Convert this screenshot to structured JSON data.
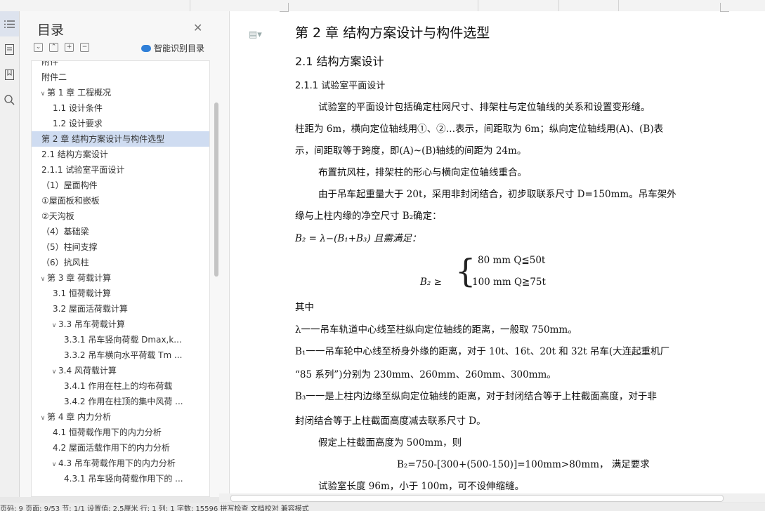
{
  "toc": {
    "title": "目录",
    "smart_label": "智能识别目录",
    "items": [
      {
        "label": "附件",
        "indent": 0,
        "arrow": ""
      },
      {
        "label": "附件二",
        "indent": 0,
        "arrow": ""
      },
      {
        "label": "第 1 章  工程概况",
        "indent": 0,
        "arrow": "∨"
      },
      {
        "label": "1.1  设计条件",
        "indent": 1,
        "arrow": ""
      },
      {
        "label": "1.2 设计要求",
        "indent": 1,
        "arrow": ""
      },
      {
        "label": "第 2 章   结构方案设计与构件选型",
        "indent": 0,
        "arrow": "",
        "selected": true
      },
      {
        "label": "2.1  结构方案设计",
        "indent": 0,
        "arrow": ""
      },
      {
        "label": "2.1.1  试验室平面设计",
        "indent": 0,
        "arrow": ""
      },
      {
        "label": "（1）屋面构件",
        "indent": 0,
        "arrow": ""
      },
      {
        "label": "①屋面板和嵌板",
        "indent": 0,
        "arrow": ""
      },
      {
        "label": "②天沟板",
        "indent": 0,
        "arrow": ""
      },
      {
        "label": "（4）基础梁",
        "indent": 0,
        "arrow": ""
      },
      {
        "label": "（5）柱间支撑",
        "indent": 0,
        "arrow": ""
      },
      {
        "label": "（6）抗风柱",
        "indent": 0,
        "arrow": ""
      },
      {
        "label": "第 3 章    荷载计算",
        "indent": 0,
        "arrow": "∨"
      },
      {
        "label": "3.1  恒荷载计算",
        "indent": 1,
        "arrow": ""
      },
      {
        "label": "3.2  屋面活荷载计算",
        "indent": 1,
        "arrow": ""
      },
      {
        "label": "3.3  吊车荷载计算",
        "indent": 1,
        "arrow": "∨"
      },
      {
        "label": "3.3.1  吊车竖向荷载 Dmax,k...",
        "indent": 2,
        "arrow": ""
      },
      {
        "label": "3.3.2  吊车横向水平荷载 Tm ...",
        "indent": 2,
        "arrow": ""
      },
      {
        "label": "3.4    风荷载计算",
        "indent": 1,
        "arrow": "∨"
      },
      {
        "label": "3.4.1  作用在柱上的均布荷载",
        "indent": 2,
        "arrow": ""
      },
      {
        "label": "3.4.2  作用在柱顶的集中风荷 ...",
        "indent": 2,
        "arrow": ""
      },
      {
        "label": "第 4 章    内力分析",
        "indent": 0,
        "arrow": "∨"
      },
      {
        "label": "4.1  恒荷载作用下的内力分析",
        "indent": 1,
        "arrow": ""
      },
      {
        "label": "4.2  屋面活载作用下的内力分析",
        "indent": 1,
        "arrow": ""
      },
      {
        "label": "4.3  吊车荷载作用下的内力分析",
        "indent": 1,
        "arrow": "∨"
      },
      {
        "label": "4.3.1  吊车竖向荷载作用下的 ...",
        "indent": 2,
        "arrow": ""
      }
    ]
  },
  "doc": {
    "chapter": "第 2 章    结构方案设计与构件选型",
    "section": "2.1  结构方案设计",
    "subsection": "2.1.1  试验室平面设计",
    "p1a": "试验室的平面设计包括确定柱网尺寸、排架柱与定位轴线的关系和设置变形缝。",
    "p1b": "柱距为 6m，横向定位轴线用①、②…表示，间距取为 6m；纵向定位轴线用(A)、(B)表",
    "p1c": "示，间距取等于跨度，即(A)~(B)轴线的间距为 24m。",
    "p2": "布置抗风柱，排架柱的形心与横向定位轴线重合。",
    "p3a": "由于吊车起重量大于 20t，采用非封闭结合，初步取联系尺寸 D=150mm。吊车架外",
    "p3b": "缘与上柱内缘的净空尺寸 B₂确定：",
    "formula1": "B₂ = λ−(B₁+B₃)  且需满足：",
    "cond_lhs": "B₂ ≥",
    "cond1": "80 mm     Q≦50t",
    "cond2": "100 mm    Q≧75t",
    "where": "其中",
    "def1": "λ一一吊车轨道中心线至柱纵向定位轴线的距离，一般取 750mm。",
    "def2a": "B₁一一吊车轮中心线至桥身外缘的距离，对于 10t、16t、20t 和 32t 吊车(大连起重机厂",
    "def2b": "“85 系列”)分别为 230mm、260mm、260mm、300mm。",
    "def3a": "B₃一一是上柱内边缘至纵向定位轴线的距离，对于封闭结合等于上柱截面高度，对于非",
    "def3b": "封闭结合等于上柱截面高度减去联系尺寸 D。",
    "p4": "假定上柱截面高度为 500mm，则",
    "calc": "B₂=750-[300+(500-150)]=100mm>80mm，   满足要求",
    "p5": "试验室长度 96m，小于 100m，可不设伸缩缝。"
  },
  "status": {
    "text": "页码: 9    页面: 9/53    节: 1/1    设置值: 2.5厘米    行: 1    列: 1    字数: 15596    拼写检查    文档校对    兼容模式"
  }
}
